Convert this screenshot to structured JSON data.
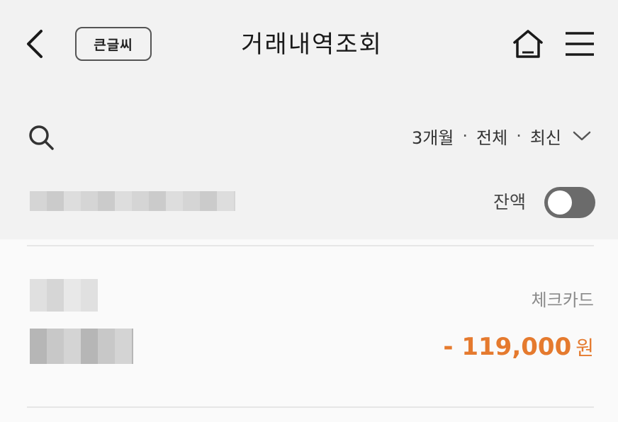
{
  "header": {
    "back_icon": "chevron-left-icon",
    "big_font_label": "큰글씨",
    "title": "거래내역조회",
    "home_icon": "home-icon",
    "menu_icon": "hamburger-menu-icon"
  },
  "toolbar": {
    "search_icon": "search-icon",
    "filter": {
      "period": "3개월",
      "type": "전체",
      "order": "최신",
      "separator": "·"
    },
    "balance_label": "잔액",
    "balance_toggle_on": false
  },
  "transactions": [
    {
      "method": "체크카드",
      "amount": "- 119,000",
      "unit": "원"
    }
  ],
  "colors": {
    "amount": "#e57a2e",
    "toggle_off": "#6b6b6b",
    "top_bg": "#f2f2f2"
  }
}
